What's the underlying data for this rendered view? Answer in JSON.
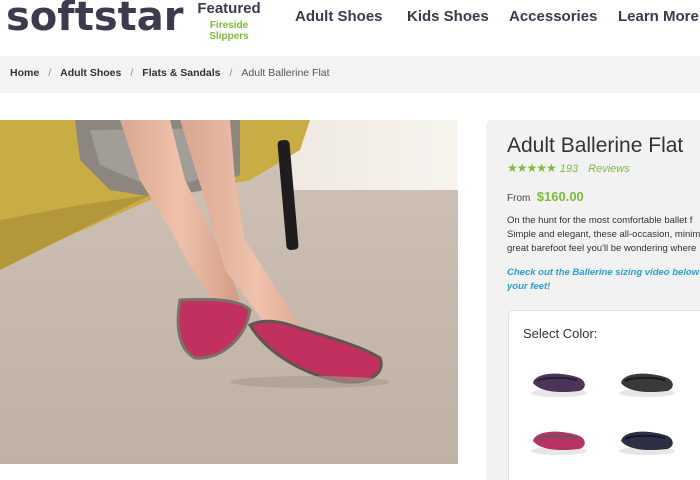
{
  "header": {
    "logo": "softstar",
    "nav": {
      "featured": "Featured",
      "featured_sub": "Fireside Slippers",
      "items": [
        "Adult Shoes",
        "Kids Shoes",
        "Accessories",
        "Learn More"
      ]
    }
  },
  "breadcrumb": {
    "items": [
      "Home",
      "Adult Shoes",
      "Flats & Sandals"
    ],
    "current": "Adult Ballerine Flat",
    "separator": "/"
  },
  "product": {
    "title": "Adult Ballerine Flat",
    "stars": "★★★★★",
    "rating_count": "193",
    "reviews_label": "Reviews",
    "price_prefix": "From",
    "price": "$160.00",
    "description_lines": [
      "On the hunt for the most comfortable ballet f",
      "Simple and elegant, these all-occasion, minim",
      "great barefoot feel you'll be wondering where"
    ],
    "sizing_link_lines": [
      "Check out the Ballerine sizing video below",
      "your feet!"
    ],
    "color_section": {
      "title": "Select Color:",
      "swatches": [
        {
          "name": "purple-swatch",
          "color": "#4a3558"
        },
        {
          "name": "charcoal-swatch",
          "color": "#3a3a38"
        },
        {
          "name": "raspberry-swatch",
          "color": "#b83266"
        },
        {
          "name": "navy-swatch",
          "color": "#2d2f45"
        }
      ]
    }
  },
  "colors": {
    "brand_dark": "#3d3a4f",
    "accent_green": "#7dbb3c",
    "link_blue": "#2a9fd6"
  }
}
